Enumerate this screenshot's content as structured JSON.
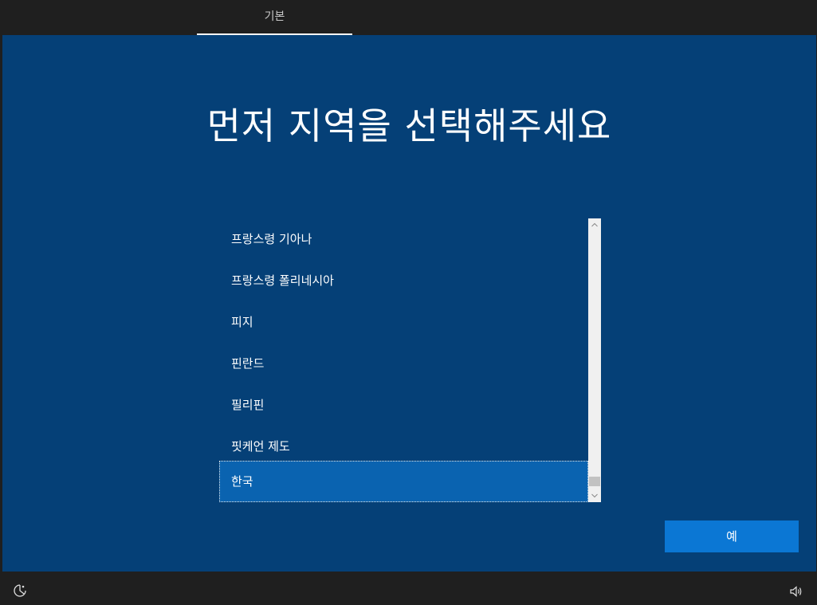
{
  "header": {
    "tab_label": "기본"
  },
  "main": {
    "title": "먼저 지역을 선택해주세요",
    "list": {
      "items": [
        {
          "label": "프랑스령 기아나",
          "selected": false
        },
        {
          "label": "프랑스령 폴리네시아",
          "selected": false
        },
        {
          "label": "피지",
          "selected": false
        },
        {
          "label": "핀란드",
          "selected": false
        },
        {
          "label": "필리핀",
          "selected": false
        },
        {
          "label": "핏케언 제도",
          "selected": false
        },
        {
          "label": "한국",
          "selected": true
        }
      ],
      "scroll_position": 0.95
    },
    "yes_button_label": "예"
  },
  "footer": {
    "left_icon": "ease-of-access-icon",
    "right_icon": "volume-icon"
  },
  "colors": {
    "background": "#054077",
    "selected": "#0a63b0",
    "button": "#0b77d4",
    "bar": "#1f1f1f"
  }
}
